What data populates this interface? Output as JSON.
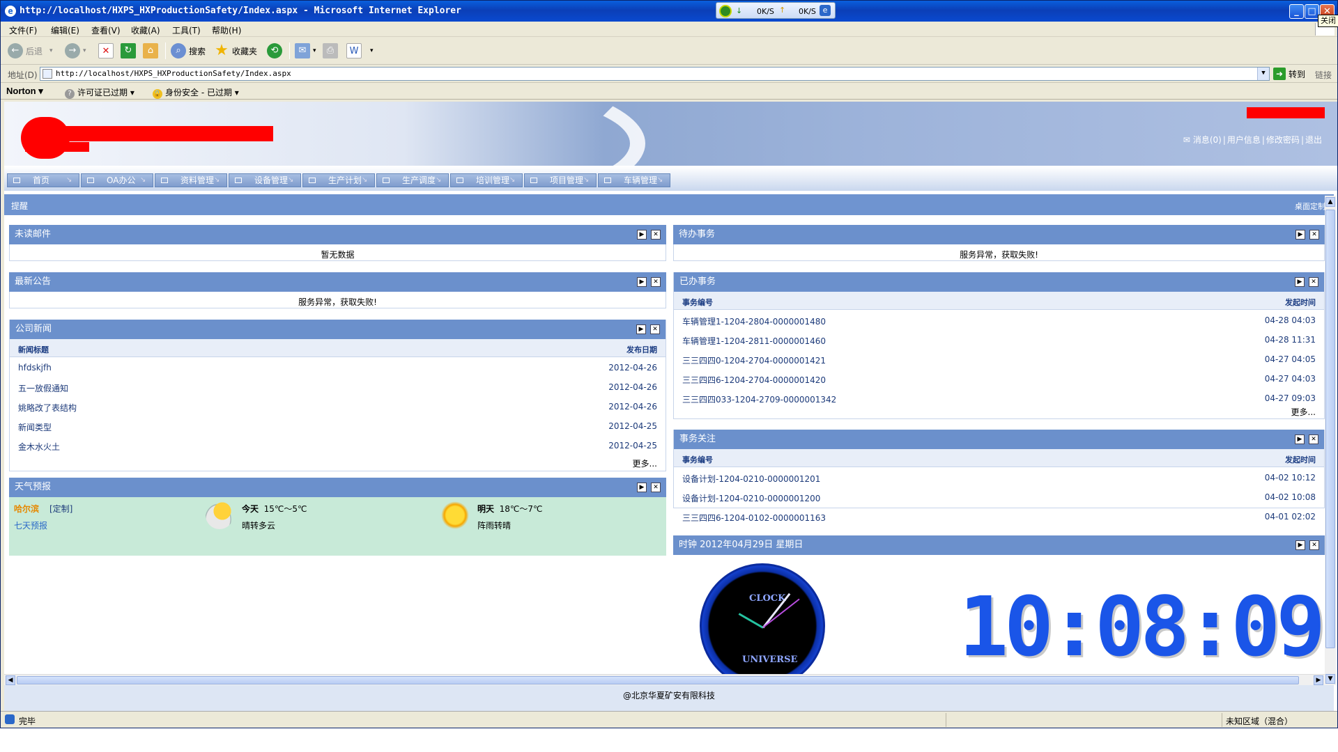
{
  "window": {
    "title": "http://localhost/HXPS_HXProductionSafety/Index.aspx - Microsoft Internet Explorer",
    "speed_down": "0K/S",
    "speed_up": "0K/S",
    "close_tip": "关闭"
  },
  "menu": [
    "文件(F)",
    "编辑(E)",
    "查看(V)",
    "收藏(A)",
    "工具(T)",
    "帮助(H)"
  ],
  "toolbar": {
    "back": "后退",
    "search": "搜索",
    "favorites": "收藏夹"
  },
  "address": {
    "label": "地址(D)",
    "url": "http://localhost/HXPS_HXProductionSafety/Index.aspx",
    "go": "转到",
    "links": "链接"
  },
  "norton": {
    "brand": "Norton",
    "license": "许可证已过期",
    "identity": "身份安全 - 已过期"
  },
  "header": {
    "links": [
      "消息(0)",
      "用户信息",
      "修改密码",
      "退出"
    ]
  },
  "nav": [
    "首页",
    "OA办公",
    "资料管理",
    "设备管理",
    "生产计划",
    "生产调度",
    "培训管理",
    "项目管理",
    "车辆管理"
  ],
  "remind": {
    "title": "提醒",
    "customize": "桌面定制"
  },
  "panels": {
    "unread_mail": {
      "title": "未读邮件",
      "message": "暂无数据"
    },
    "announcements": {
      "title": "最新公告",
      "message": "服务异常，获取失败!"
    },
    "news": {
      "title": "公司新闻",
      "col1": "新闻标题",
      "col2": "发布日期",
      "rows": [
        {
          "title": "hfdskjfh",
          "date": "2012-04-26"
        },
        {
          "title": "五一放假通知",
          "date": "2012-04-26"
        },
        {
          "title": "姚略改了表结构",
          "date": "2012-04-26"
        },
        {
          "title": "新闻类型",
          "date": "2012-04-25"
        },
        {
          "title": "金木水火土",
          "date": "2012-04-25"
        }
      ],
      "more": "更多..."
    },
    "weather": {
      "title": "天气预报",
      "city": "哈尔滨",
      "customize": "[定制]",
      "seven_day": "七天预报",
      "today_label": "今天",
      "today_temp": "15℃～5℃",
      "today_desc": "晴转多云",
      "tomorrow_label": "明天",
      "tomorrow_temp": "18℃～7℃",
      "tomorrow_desc": "阵雨转晴"
    },
    "todo": {
      "title": "待办事务",
      "message": "服务异常，获取失败!"
    },
    "done": {
      "title": "已办事务",
      "col1": "事务编号",
      "col2": "发起时间",
      "rows": [
        {
          "id": "车辆管理1-1204-2804-0000001480",
          "time": "04-28 04:03"
        },
        {
          "id": "车辆管理1-1204-2811-0000001460",
          "time": "04-28 11:31"
        },
        {
          "id": "三三四四0-1204-2704-0000001421",
          "time": "04-27 04:05"
        },
        {
          "id": "三三四四6-1204-2704-0000001420",
          "time": "04-27 04:03"
        },
        {
          "id": "三三四四033-1204-2709-0000001342",
          "time": "04-27 09:03"
        }
      ],
      "more": "更多..."
    },
    "watch": {
      "title": "事务关注",
      "col1": "事务编号",
      "col2": "发起时间",
      "rows": [
        {
          "id": "设备计划-1204-0210-0000001201",
          "time": "04-02 10:12"
        },
        {
          "id": "设备计划-1204-0210-0000001200",
          "time": "04-02 10:08"
        },
        {
          "id": "三三四四6-1204-0102-0000001163",
          "time": "04-01 02:02"
        }
      ]
    },
    "clock": {
      "title": "时钟  2012年04月29日  星期日",
      "analog_top": "CLOCK",
      "analog_bottom": "UNIVERSE",
      "digital": "10:08:09"
    }
  },
  "footer": "@北京华夏矿安有限科技",
  "status": {
    "left": "完毕",
    "right": "未知区域（混合）"
  }
}
